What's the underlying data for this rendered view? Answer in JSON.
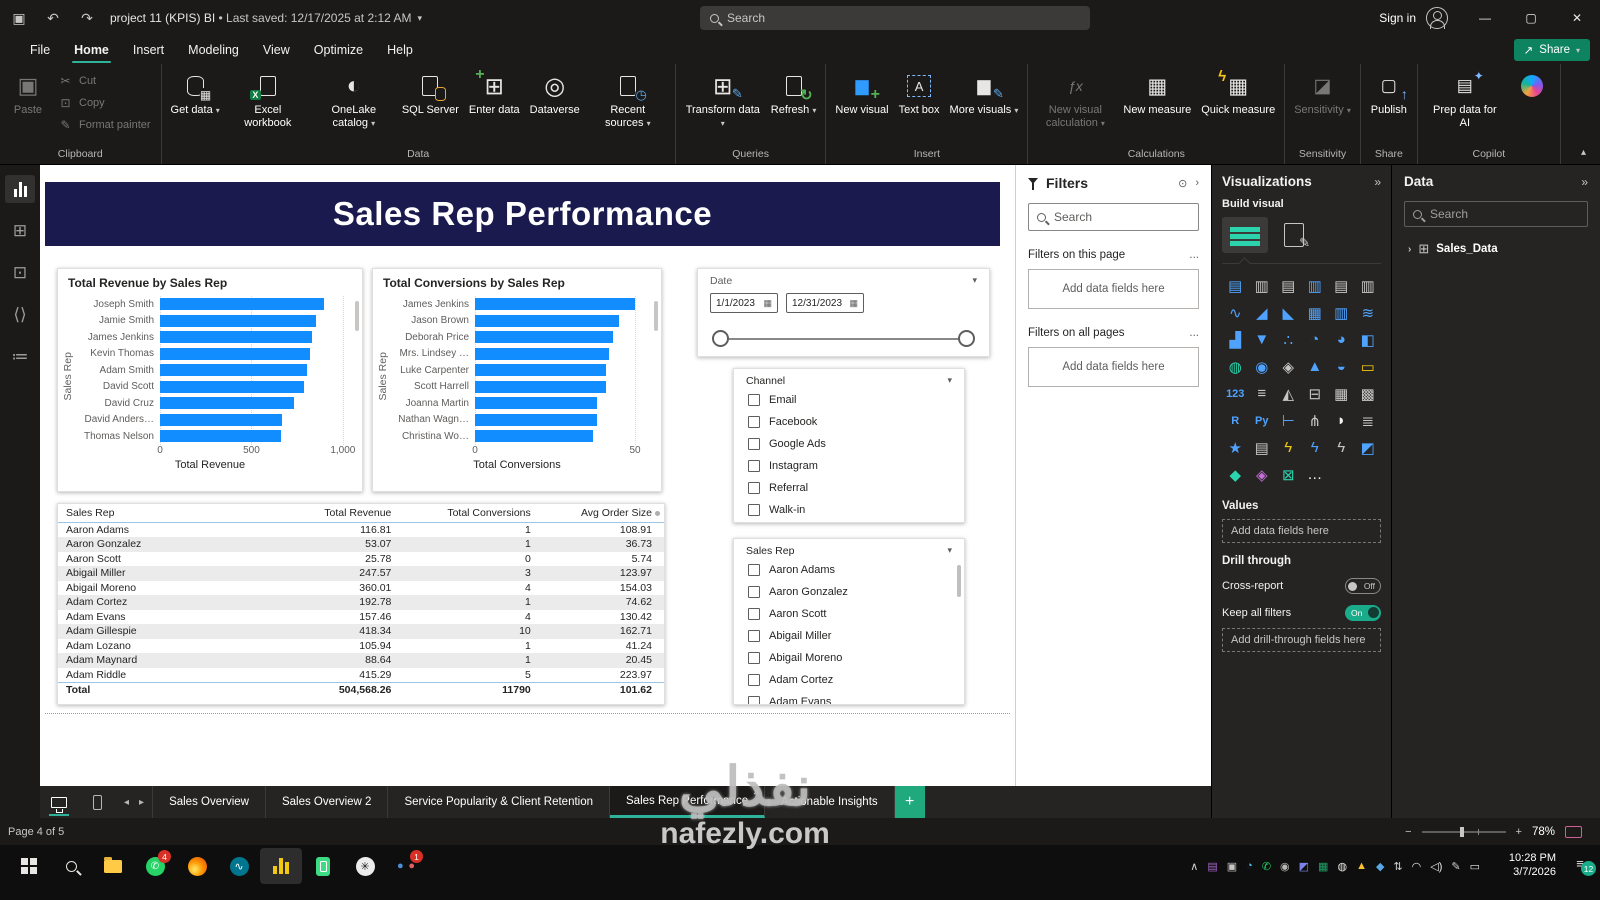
{
  "titlebar": {
    "title": "project 11 (KPIS) BI",
    "subtitle": "• Last saved: 12/17/2025 at 2:12 AM",
    "search_placeholder": "Search",
    "sign_in": "Sign in"
  },
  "menubar": {
    "items": [
      "File",
      "Home",
      "Insert",
      "Modeling",
      "View",
      "Optimize",
      "Help"
    ],
    "active": "Home",
    "share_label": "Share"
  },
  "ribbon": {
    "groups": [
      {
        "label": "Clipboard",
        "buttons": [
          {
            "label": "Paste",
            "icon": "paste",
            "disabled": true,
            "big": true
          },
          {
            "label": "Cut",
            "icon": "cut",
            "disabled": true
          },
          {
            "label": "Copy",
            "icon": "copy",
            "disabled": true
          },
          {
            "label": "Format painter",
            "icon": "format-painter",
            "disabled": true
          }
        ]
      },
      {
        "label": "Data",
        "buttons": [
          {
            "label": "Get data",
            "icon": "get-data",
            "dropdown": true
          },
          {
            "label": "Excel workbook",
            "icon": "excel-workbook"
          },
          {
            "label": "OneLake catalog",
            "icon": "onelake-catalog",
            "dropdown": true
          },
          {
            "label": "SQL Server",
            "icon": "sql-server"
          },
          {
            "label": "Enter data",
            "icon": "enter-data"
          },
          {
            "label": "Dataverse",
            "icon": "dataverse"
          },
          {
            "label": "Recent sources",
            "icon": "recent-sources",
            "dropdown": true
          }
        ]
      },
      {
        "label": "Queries",
        "buttons": [
          {
            "label": "Transform data",
            "icon": "transform-data",
            "dropdown": true
          },
          {
            "label": "Refresh",
            "icon": "refresh",
            "dropdown": true
          }
        ]
      },
      {
        "label": "Insert",
        "buttons": [
          {
            "label": "New visual",
            "icon": "new-visual"
          },
          {
            "label": "Text box",
            "icon": "text-box"
          },
          {
            "label": "More visuals",
            "icon": "more-visuals",
            "dropdown": true
          }
        ]
      },
      {
        "label": "Calculations",
        "buttons": [
          {
            "label": "New visual calculation",
            "icon": "new-visual-calculation",
            "dropdown": true,
            "disabled": true
          },
          {
            "label": "New measure",
            "icon": "new-measure"
          },
          {
            "label": "Quick measure",
            "icon": "quick-measure"
          }
        ]
      },
      {
        "label": "Sensitivity",
        "buttons": [
          {
            "label": "Sensitivity",
            "icon": "sensitivity",
            "dropdown": true,
            "disabled": true
          }
        ]
      },
      {
        "label": "Share",
        "buttons": [
          {
            "label": "Publish",
            "icon": "publish"
          }
        ]
      },
      {
        "label": "Copilot",
        "buttons": [
          {
            "label": "Prep data for AI",
            "icon": "prep-data"
          },
          {
            "label": "",
            "icon": "copilot"
          }
        ]
      }
    ]
  },
  "sidebar": {
    "items": [
      "report-view",
      "table-view",
      "model-view",
      "dax-query-view",
      "tmdl-view"
    ]
  },
  "canvas": {
    "banner_title": "Sales Rep Performance",
    "date_slicer": {
      "title": "Date",
      "start": "1/1/2023",
      "end": "12/31/2023"
    },
    "channel_slicer": {
      "title": "Channel",
      "options": [
        "Email",
        "Facebook",
        "Google Ads",
        "Instagram",
        "Referral",
        "Walk-in"
      ]
    },
    "rep_slicer": {
      "title": "Sales Rep",
      "options": [
        "Aaron Adams",
        "Aaron Gonzalez",
        "Aaron Scott",
        "Abigail Miller",
        "Abigail Moreno",
        "Adam Cortez",
        "Adam Evans"
      ]
    },
    "table": {
      "columns": [
        "Sales Rep",
        "Total Revenue",
        "Total Conversions",
        "Avg Order Size"
      ],
      "rows": [
        [
          "Aaron Adams",
          "116.81",
          "1",
          "108.91"
        ],
        [
          "Aaron Gonzalez",
          "53.07",
          "1",
          "36.73"
        ],
        [
          "Aaron Scott",
          "25.78",
          "0",
          "5.74"
        ],
        [
          "Abigail Miller",
          "247.57",
          "3",
          "123.97"
        ],
        [
          "Abigail Moreno",
          "360.01",
          "4",
          "154.03"
        ],
        [
          "Adam Cortez",
          "192.78",
          "1",
          "74.62"
        ],
        [
          "Adam Evans",
          "157.46",
          "4",
          "130.42"
        ],
        [
          "Adam Gillespie",
          "418.34",
          "10",
          "162.71"
        ],
        [
          "Adam Lozano",
          "105.94",
          "1",
          "41.24"
        ],
        [
          "Adam Maynard",
          "88.64",
          "1",
          "20.45"
        ],
        [
          "Adam Riddle",
          "415.29",
          "5",
          "223.97"
        ]
      ],
      "total": [
        "Total",
        "504,568.26",
        "11790",
        "101.62"
      ]
    }
  },
  "chart_data": [
    {
      "type": "bar",
      "orientation": "horizontal",
      "title": "Total Revenue by Sales Rep",
      "xlabel": "Total Revenue",
      "ylabel": "Sales Rep",
      "categories": [
        "Joseph Smith",
        "Jamie Smith",
        "James Jenkins",
        "Kevin Thomas",
        "Adam Smith",
        "David Scott",
        "David Cruz",
        "David Anders…",
        "Thomas Nelson"
      ],
      "values": [
        895,
        855,
        830,
        820,
        805,
        790,
        735,
        665,
        660
      ],
      "xticks": {
        "labels": [
          "0",
          "500",
          "1,000"
        ],
        "values": [
          0,
          500,
          1000
        ]
      },
      "xlim": [
        0,
        1050
      ],
      "bar_color": "#118DFF",
      "grid": "dotted"
    },
    {
      "type": "bar",
      "orientation": "horizontal",
      "title": "Total Conversions by Sales Rep",
      "xlabel": "Total Conversions",
      "ylabel": "Sales Rep",
      "categories": [
        "James Jenkins",
        "Jason Brown",
        "Deborah Price",
        "Mrs. Lindsey …",
        "Luke Carpenter",
        "Scott Harrell",
        "Joanna Martin",
        "Nathan Wagn…",
        "Christina Wo…"
      ],
      "values": [
        50,
        45,
        43,
        42,
        41,
        41,
        38,
        38,
        37
      ],
      "xticks": {
        "labels": [
          "0",
          "50"
        ],
        "values": [
          0,
          50
        ]
      },
      "xlim": [
        0,
        55
      ],
      "bar_color": "#118DFF",
      "grid": "dotted"
    }
  ],
  "filters_pane": {
    "title": "Filters",
    "search_placeholder": "Search",
    "section_page": "Filters on this page",
    "section_all": "Filters on all pages",
    "add_fields": "Add data fields here",
    "add_fields2": "Add data fields here",
    "more": "..."
  },
  "viz_pane": {
    "title": "Visualizations",
    "build_visual": "Build visual",
    "icons": [
      "stacked-bar-chart",
      "stacked-column-chart",
      "clustered-bar-chart",
      "clustered-column-chart",
      "100-stacked-bar-chart",
      "100-stacked-column-chart",
      "line-chart",
      "area-chart",
      "stacked-area-chart",
      "line-and-stacked-column-chart",
      "line-and-clustered-column-chart",
      "ribbon-chart",
      "waterfall-chart",
      "funnel-chart",
      "scatter-chart",
      "pie-chart",
      "donut-chart",
      "treemap",
      "map",
      "filled-map",
      "shape-map",
      "azure-map",
      "gauge",
      "new-card",
      "card",
      "multi-row-card",
      "kpi",
      "slicer",
      "table",
      "matrix",
      "r-script-visual",
      "python-visual",
      "key-influencers",
      "decomposition-tree",
      "qa-visual",
      "smart-narrative",
      "metrics",
      "paginated-report",
      "power-apps",
      "power-automate",
      "automation-visual",
      "insights-visual",
      "arcgis-map",
      "appsource-visual",
      "get-more-visuals",
      "more-options"
    ],
    "values_label": "Values",
    "add_fields": "Add data fields here",
    "drill_through": "Drill through",
    "cross_report": "Cross-report",
    "cross_report_state": "Off",
    "keep_filters": "Keep all filters",
    "keep_filters_state": "On",
    "add_drill_fields": "Add drill-through fields here"
  },
  "data_pane": {
    "title": "Data",
    "search_placeholder": "Search",
    "tables": [
      "Sales_Data"
    ]
  },
  "tabbar": {
    "tabs": [
      "Sales Overview",
      "Sales Overview 2",
      "Service Popularity & Client Retention",
      "Sales Rep Performance",
      "Actionable Insights"
    ],
    "active": "Sales Rep Performance"
  },
  "statusbar": {
    "page_label": "Page 4 of 5",
    "zoom": "78%"
  },
  "taskbar": {
    "apps": [
      {
        "name": "start"
      },
      {
        "name": "search"
      },
      {
        "name": "file-explorer"
      },
      {
        "name": "whatsapp",
        "badge": "4"
      },
      {
        "name": "firefox"
      },
      {
        "name": "mysql-workbench"
      },
      {
        "name": "power-bi",
        "active": true
      },
      {
        "name": "green-phone-app"
      },
      {
        "name": "chatgpt"
      },
      {
        "name": "people-app",
        "badge": "1"
      }
    ],
    "tray": [
      "hidden-icons",
      "onenote",
      "clipboard",
      "edge",
      "whatsapp-tray",
      "obs",
      "teams",
      "excel",
      "chrome",
      "drive",
      "defender",
      "ethernet",
      "wifi",
      "volume",
      "pen",
      "battery"
    ],
    "clock": {
      "time": "10:28 PM",
      "date": "3/7/2026"
    },
    "notification_badge": "12"
  },
  "watermark": {
    "line1": "نفذلي",
    "line2": "nafezly.com"
  }
}
